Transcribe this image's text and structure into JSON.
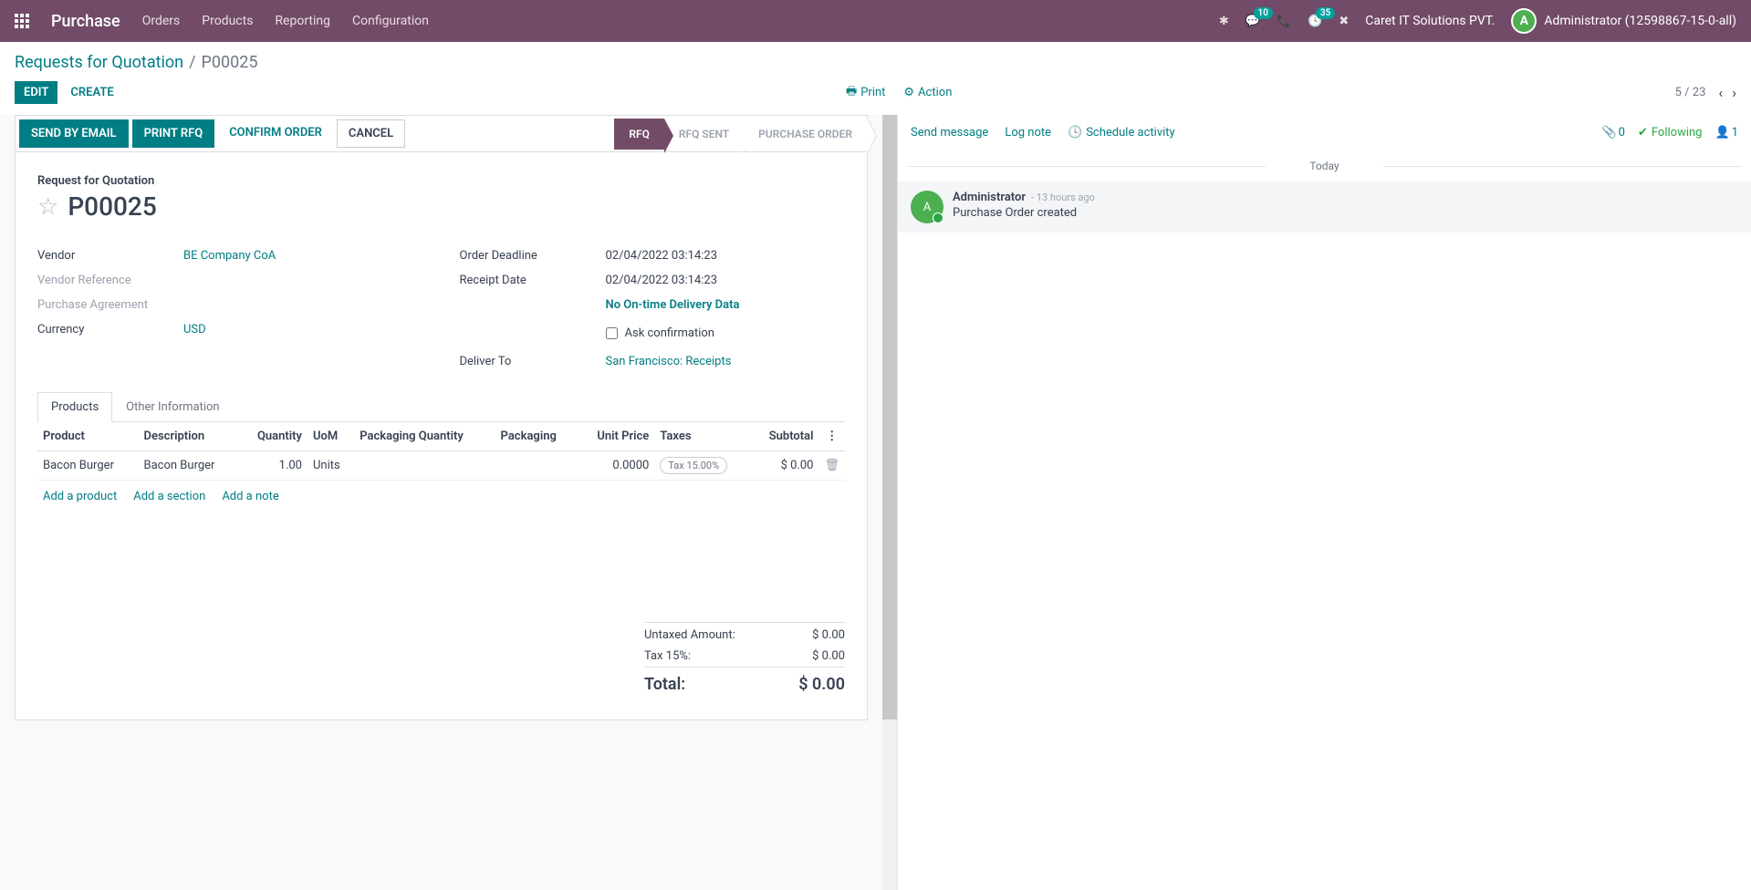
{
  "topbar": {
    "brand": "Purchase",
    "nav": [
      "Orders",
      "Products",
      "Reporting",
      "Configuration"
    ],
    "msg_badge": "10",
    "activity_badge": "35",
    "company": "Caret IT Solutions PVT.",
    "user": "Administrator (12598867-15-0-all)"
  },
  "breadcrumb": {
    "parent": "Requests for Quotation",
    "current": "P00025"
  },
  "toolbar": {
    "edit": "EDIT",
    "create": "CREATE",
    "print": "Print",
    "action": "Action",
    "pager": "5 / 23"
  },
  "status_buttons": {
    "send_email": "SEND BY EMAIL",
    "print_rfq": "PRINT RFQ",
    "confirm": "CONFIRM ORDER",
    "cancel": "CANCEL"
  },
  "status_steps": {
    "rfq": "RFQ",
    "sent": "RFQ SENT",
    "po": "PURCHASE ORDER"
  },
  "doc": {
    "subtitle": "Request for Quotation",
    "name": "P00025",
    "labels": {
      "vendor": "Vendor",
      "vendor_ref": "Vendor Reference",
      "agreement": "Purchase Agreement",
      "currency": "Currency",
      "deadline": "Order Deadline",
      "receipt": "Receipt Date",
      "ontime": "No On-time Delivery Data",
      "ask": "Ask confirmation",
      "deliver": "Deliver To"
    },
    "vendor": "BE Company CoA",
    "currency": "USD",
    "deadline": "02/04/2022 03:14:23",
    "receipt": "02/04/2022 03:14:23",
    "deliver": "San Francisco: Receipts"
  },
  "tabs": [
    "Products",
    "Other Information"
  ],
  "table": {
    "headers": {
      "product": "Product",
      "desc": "Description",
      "qty": "Quantity",
      "uom": "UoM",
      "pkgqty": "Packaging Quantity",
      "pkg": "Packaging",
      "price": "Unit Price",
      "taxes": "Taxes",
      "subtotal": "Subtotal"
    },
    "row": {
      "product": "Bacon Burger",
      "desc": "Bacon Burger",
      "qty": "1.00",
      "uom": "Units",
      "price": "0.0000",
      "tax": "Tax 15.00%",
      "subtotal": "$ 0.00"
    },
    "add": {
      "product": "Add a product",
      "section": "Add a section",
      "note": "Add a note"
    }
  },
  "totals": {
    "untaxed_l": "Untaxed Amount:",
    "untaxed_v": "$ 0.00",
    "tax_l": "Tax 15%:",
    "tax_v": "$ 0.00",
    "total_l": "Total:",
    "total_v": "$ 0.00"
  },
  "chatter": {
    "send": "Send message",
    "log": "Log note",
    "schedule": "Schedule activity",
    "attach_count": "0",
    "following": "Following",
    "followers": "1",
    "today": "Today",
    "author": "Administrator",
    "time": "- 13 hours ago",
    "text": "Purchase Order created"
  }
}
